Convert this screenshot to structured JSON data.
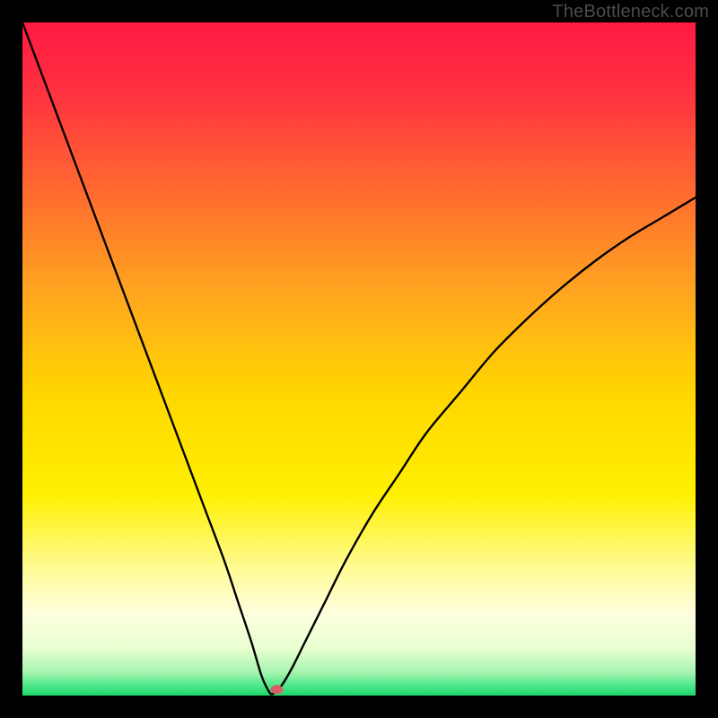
{
  "watermark": "TheBottleneck.com",
  "chart_data": {
    "type": "line",
    "title": "",
    "xlabel": "",
    "ylabel": "",
    "xlim": [
      0,
      100
    ],
    "ylim": [
      0,
      100
    ],
    "background_gradient": {
      "stops": [
        {
          "offset": 0.0,
          "color": "#ff1a42"
        },
        {
          "offset": 0.1,
          "color": "#ff3040"
        },
        {
          "offset": 0.25,
          "color": "#ff6a30"
        },
        {
          "offset": 0.4,
          "color": "#ffa520"
        },
        {
          "offset": 0.55,
          "color": "#ffd600"
        },
        {
          "offset": 0.7,
          "color": "#fff000"
        },
        {
          "offset": 0.82,
          "color": "#fffca0"
        },
        {
          "offset": 0.88,
          "color": "#ffffe0"
        },
        {
          "offset": 0.93,
          "color": "#e8ffd0"
        },
        {
          "offset": 0.965,
          "color": "#a8f5b0"
        },
        {
          "offset": 0.985,
          "color": "#4fe88a"
        },
        {
          "offset": 1.0,
          "color": "#1fd66a"
        }
      ]
    },
    "series": [
      {
        "name": "bottleneck-curve",
        "x": [
          0,
          3,
          6,
          9,
          12,
          15,
          18,
          21,
          24,
          27,
          30,
          32,
          34,
          35.5,
          36.5,
          37,
          37.5,
          38.5,
          40,
          42,
          45,
          48,
          52,
          56,
          60,
          65,
          70,
          75,
          80,
          85,
          90,
          95,
          100
        ],
        "y": [
          100,
          92,
          84,
          76,
          68,
          60,
          52,
          44,
          36,
          28,
          20,
          14,
          8,
          3,
          0.8,
          0.2,
          0.5,
          1.5,
          4,
          8,
          14,
          20,
          27,
          33,
          39,
          45,
          51,
          56,
          60.5,
          64.5,
          68,
          71,
          74
        ]
      }
    ],
    "marker": {
      "x": 37.8,
      "y": 0.9,
      "color": "#d9606b"
    }
  }
}
